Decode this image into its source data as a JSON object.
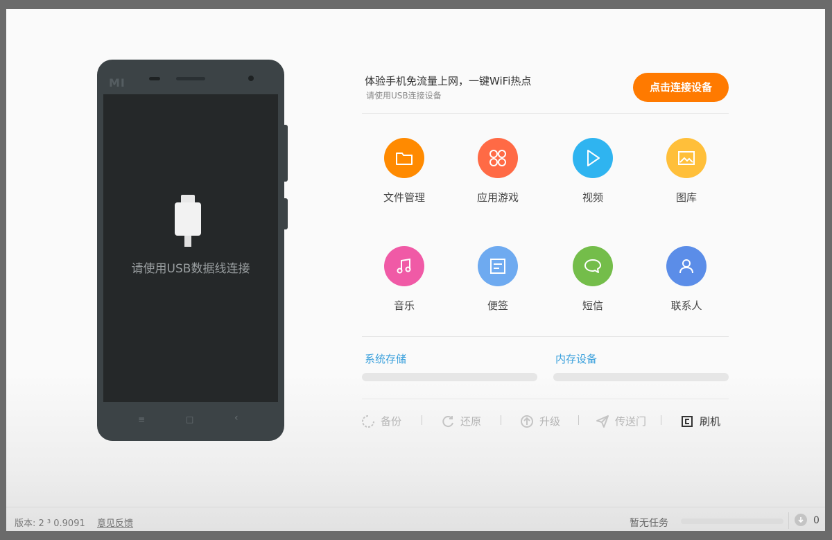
{
  "phone": {
    "brand": "MI",
    "screen_message": "请使用USB数据线连接",
    "nav": {
      "menu": "≡",
      "home": "□",
      "back": "‹"
    }
  },
  "promo": {
    "title": "体验手机免流量上网，一键WiFi热点",
    "subtitle": "请使用USB连接设备",
    "connect_button": "点击连接设备",
    "accent_color": "#ff7a00"
  },
  "tiles": [
    {
      "label": "文件管理",
      "icon": "folder-icon",
      "color": "#ff8a00"
    },
    {
      "label": "应用游戏",
      "icon": "apps-icon",
      "color": "#ff6a45"
    },
    {
      "label": "视频",
      "icon": "play-icon",
      "color": "#2fb4f0"
    },
    {
      "label": "图库",
      "icon": "image-icon",
      "color": "#ffbf3a"
    },
    {
      "label": "音乐",
      "icon": "music-icon",
      "color": "#f05aa6"
    },
    {
      "label": "便签",
      "icon": "note-icon",
      "color": "#6eaaf0"
    },
    {
      "label": "短信",
      "icon": "message-icon",
      "color": "#74bd4a"
    },
    {
      "label": "联系人",
      "icon": "contact-icon",
      "color": "#5b8de8"
    }
  ],
  "storage": {
    "system_label": "系统存储",
    "memory_label": "内存设备"
  },
  "tools": {
    "backup": "备份",
    "restore": "还原",
    "upgrade": "升级",
    "transfer": "传送门",
    "flash": "刷机"
  },
  "footer": {
    "version": "版本: 2 ³ 0.9091",
    "feedback": "意见反馈",
    "task_status": "暂无任务",
    "download_count": "0"
  }
}
